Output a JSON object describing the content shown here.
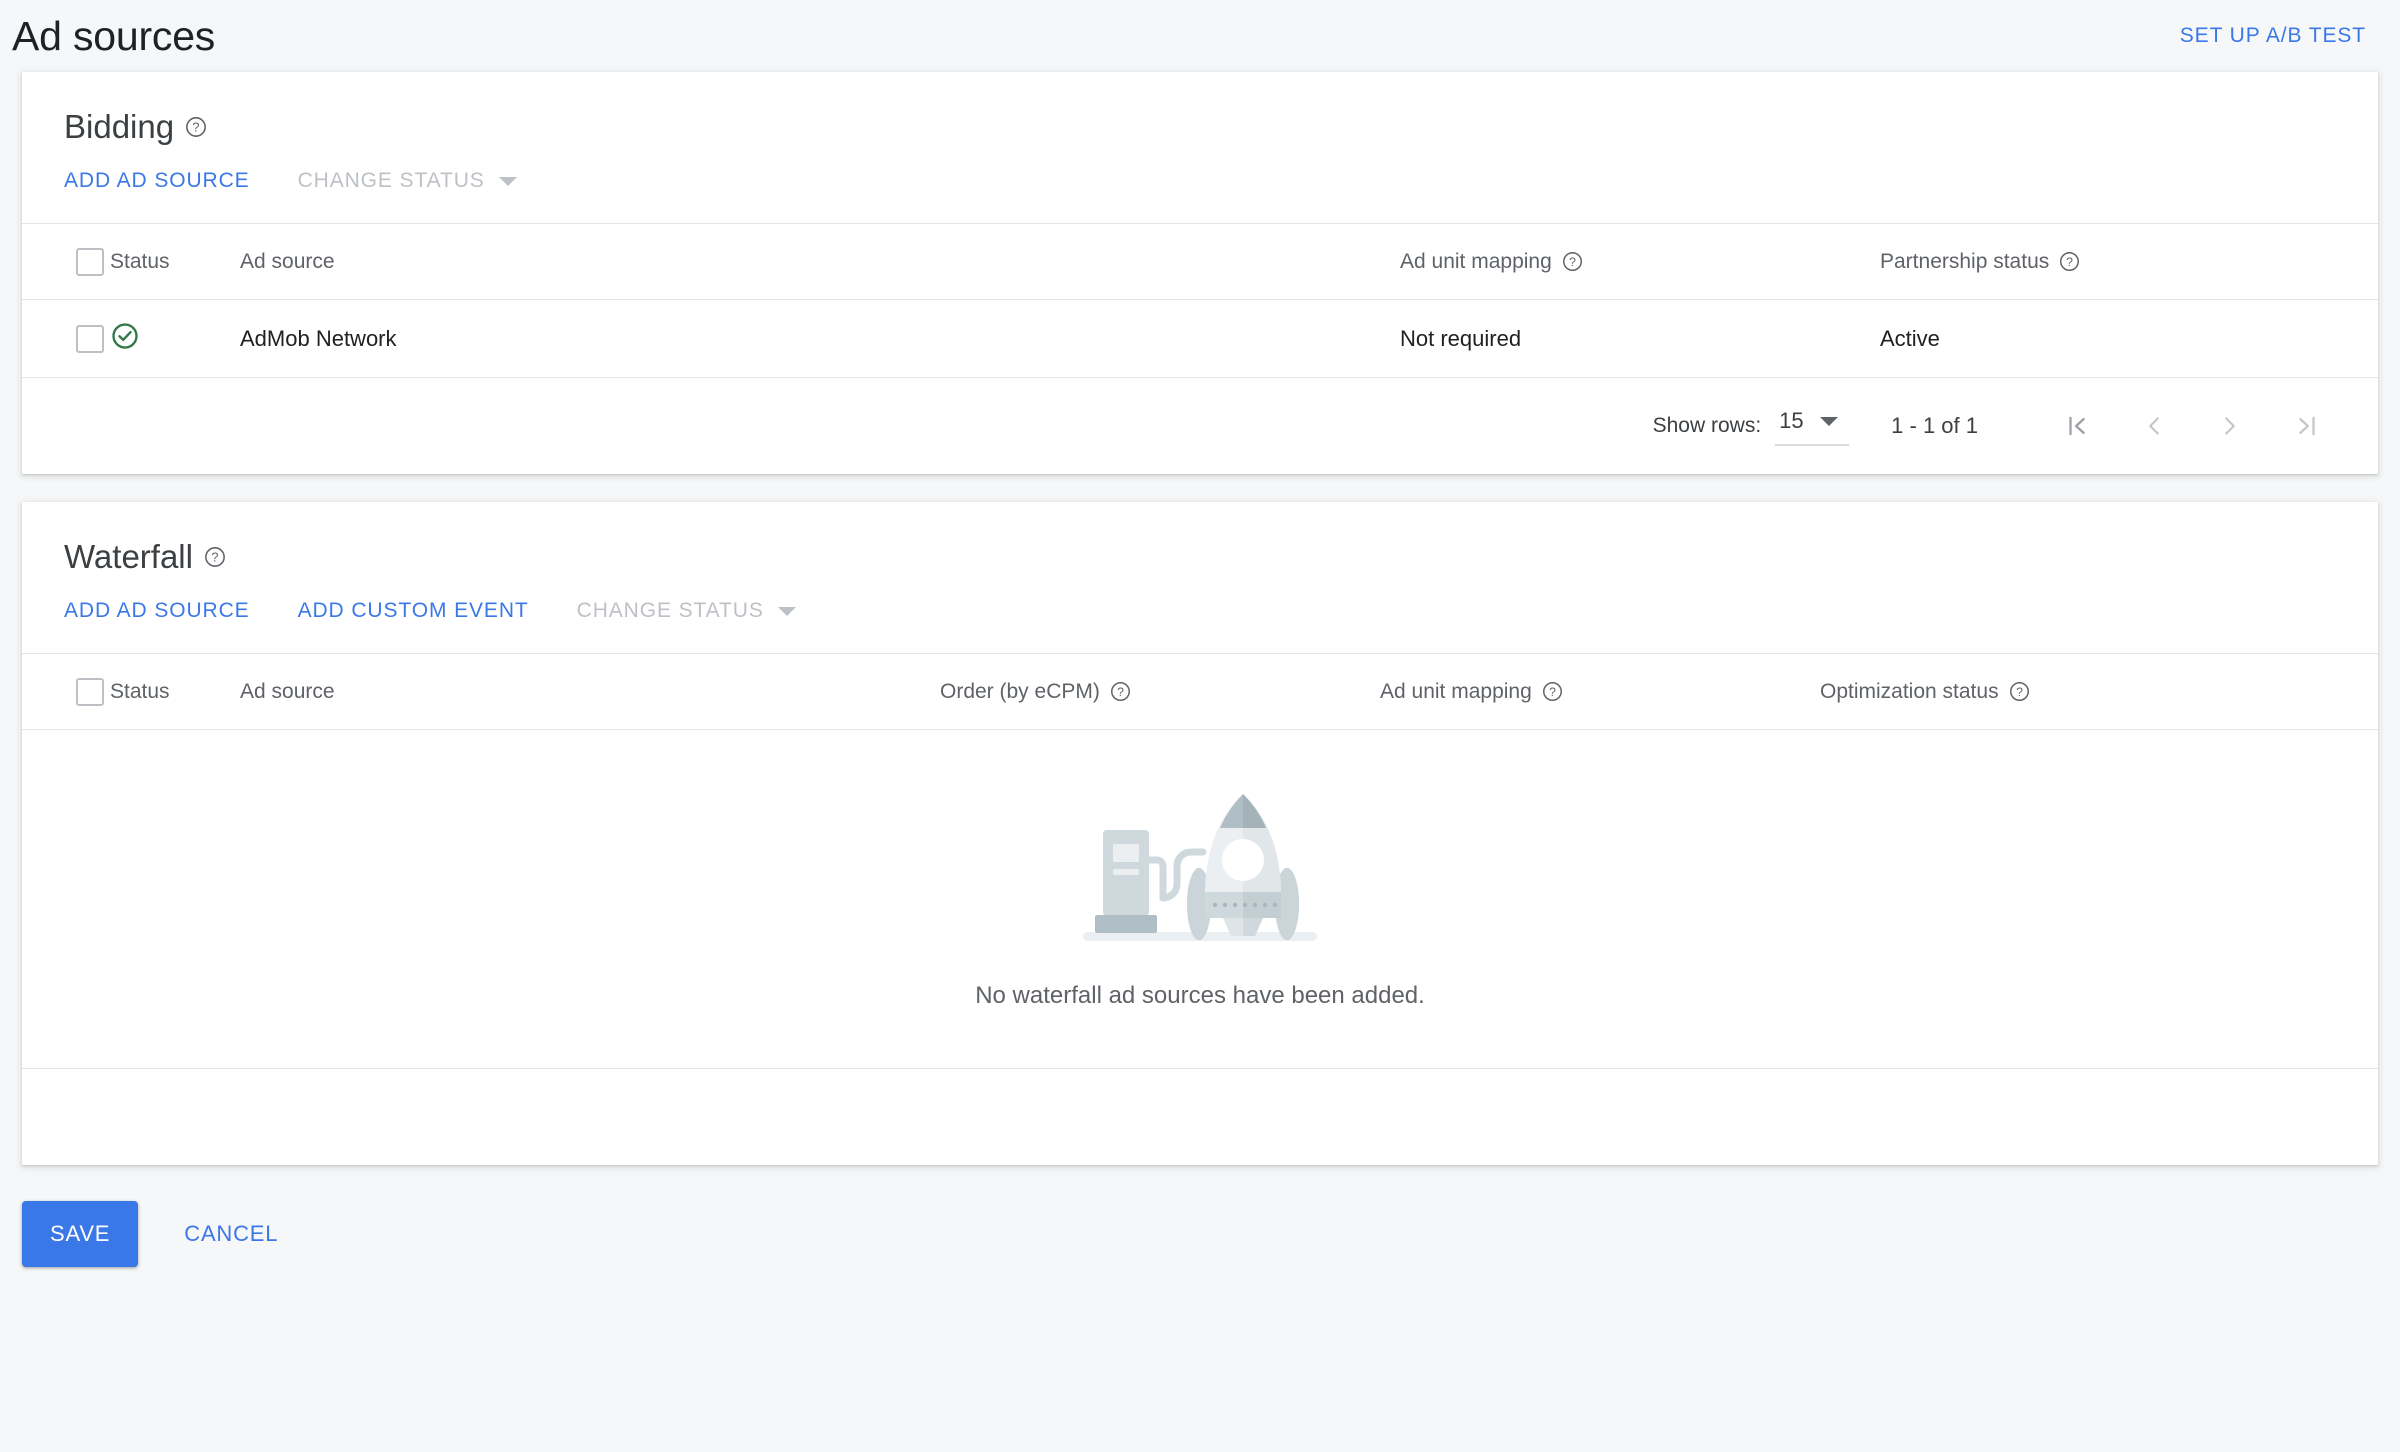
{
  "header": {
    "title": "Ad sources",
    "ab_test_label": "SET UP A/B TEST"
  },
  "colors": {
    "accent_blue": "#3b78e7",
    "status_green": "#34794a",
    "text_primary": "#202124",
    "text_secondary": "#5f6368",
    "disabled_grey": "#bdc1c6",
    "page_bg": "#f6f7f8",
    "card_bg": "#ffffff",
    "divider": "#e4e5e7",
    "illustration_light": "#eceff1",
    "illustration_mid": "#cfd8dc",
    "illustration_dark": "#b0bec5"
  },
  "bidding": {
    "title": "Bidding",
    "help_icon": "help-circle-icon",
    "actions": {
      "add_ad_source": "ADD AD SOURCE",
      "change_status": "CHANGE STATUS",
      "change_status_icon": "chevron-down-icon"
    },
    "columns": {
      "status": "Status",
      "ad_source": "Ad source",
      "ad_unit_mapping": "Ad unit mapping",
      "partnership_status": "Partnership status"
    },
    "rows": [
      {
        "status_icon": "check-circle-icon",
        "status_value": "Active",
        "ad_source": "AdMob Network",
        "ad_unit_mapping": "Not required",
        "partnership_status": "Active"
      }
    ],
    "pagination": {
      "show_rows_label": "Show rows:",
      "rows_per_page": "15",
      "rows_per_page_icon": "chevron-down-icon",
      "range": "1 - 1 of 1",
      "first_icon": "first-page-icon",
      "prev_icon": "previous-page-icon",
      "next_icon": "next-page-icon",
      "last_icon": "last-page-icon"
    }
  },
  "waterfall": {
    "title": "Waterfall",
    "help_icon": "help-circle-icon",
    "actions": {
      "add_ad_source": "ADD AD SOURCE",
      "add_custom_event": "ADD CUSTOM EVENT",
      "change_status": "CHANGE STATUS",
      "change_status_icon": "chevron-down-icon"
    },
    "columns": {
      "status": "Status",
      "ad_source": "Ad source",
      "order_by_ecpm": "Order (by eCPM)",
      "ad_unit_mapping": "Ad unit mapping",
      "optimization_status": "Optimization status"
    },
    "rows": [],
    "empty_state": {
      "illustration": "rocket-and-fuel-pump-illustration",
      "message": "No waterfall ad sources have been added."
    }
  },
  "footer": {
    "save_label": "SAVE",
    "cancel_label": "CANCEL"
  }
}
